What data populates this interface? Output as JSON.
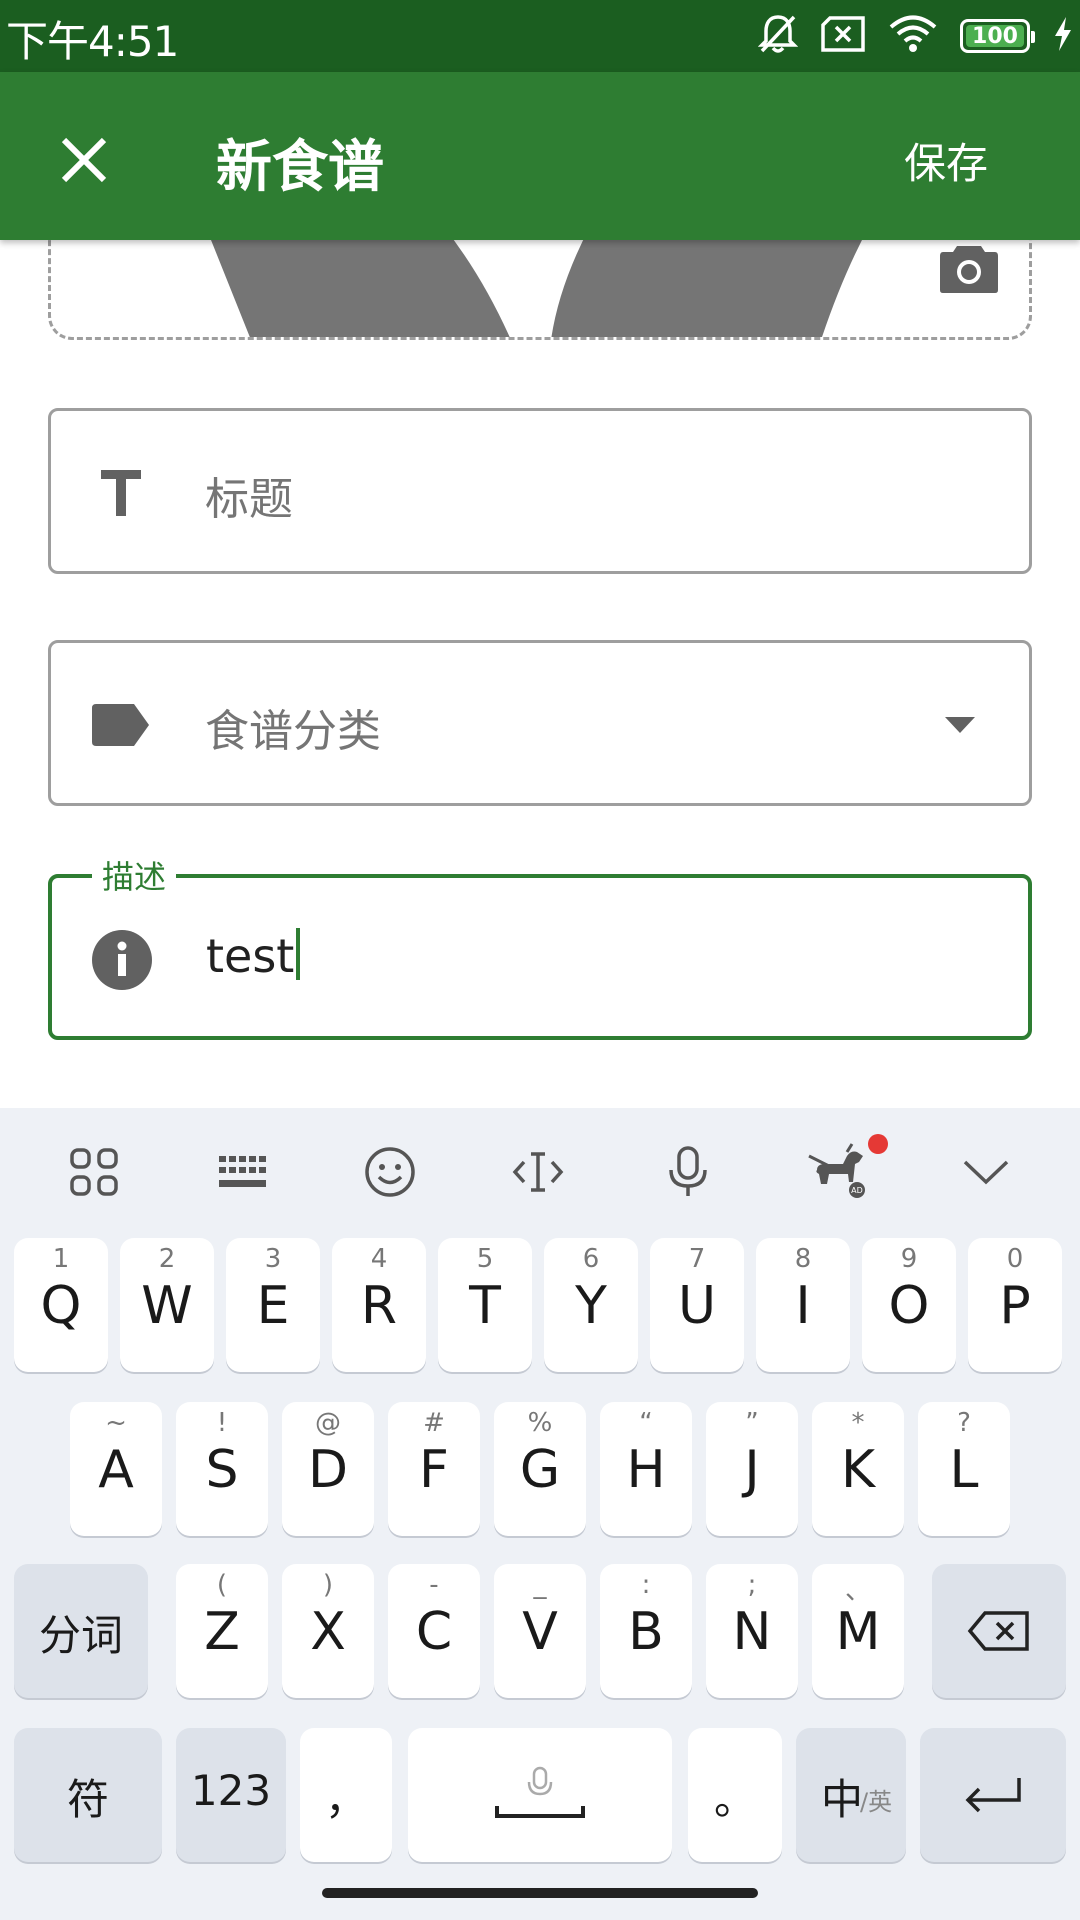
{
  "status_bar": {
    "time": "下午4:51",
    "battery": "100"
  },
  "app_bar": {
    "title": "新食谱",
    "save_label": "保存"
  },
  "form": {
    "title_placeholder": "标题",
    "category_placeholder": "食谱分类",
    "description_label": "描述",
    "description_value": "test"
  },
  "keyboard": {
    "row1": [
      {
        "k": "Q",
        "s": "1"
      },
      {
        "k": "W",
        "s": "2"
      },
      {
        "k": "E",
        "s": "3"
      },
      {
        "k": "R",
        "s": "4"
      },
      {
        "k": "T",
        "s": "5"
      },
      {
        "k": "Y",
        "s": "6"
      },
      {
        "k": "U",
        "s": "7"
      },
      {
        "k": "I",
        "s": "8"
      },
      {
        "k": "O",
        "s": "9"
      },
      {
        "k": "P",
        "s": "0"
      }
    ],
    "row2": [
      {
        "k": "A",
        "s": "~"
      },
      {
        "k": "S",
        "s": "!"
      },
      {
        "k": "D",
        "s": "@"
      },
      {
        "k": "F",
        "s": "#"
      },
      {
        "k": "G",
        "s": "%"
      },
      {
        "k": "H",
        "s": "“"
      },
      {
        "k": "J",
        "s": "”"
      },
      {
        "k": "K",
        "s": "*"
      },
      {
        "k": "L",
        "s": "?"
      }
    ],
    "row3": [
      {
        "k": "Z",
        "s": "("
      },
      {
        "k": "X",
        "s": ")"
      },
      {
        "k": "C",
        "s": "-"
      },
      {
        "k": "V",
        "s": "_"
      },
      {
        "k": "B",
        "s": ":"
      },
      {
        "k": "N",
        "s": ";"
      },
      {
        "k": "M",
        "s": "、"
      }
    ],
    "segment_label": "分词",
    "symbols_label": "符",
    "numbers_label": "123",
    "comma_label": "，",
    "period_label": "。",
    "lang_label": "中",
    "lang_sub": "/英"
  },
  "colors": {
    "primary": "#2e7d32",
    "primary_dark": "#1b5e20",
    "notification_dot": "#e53935"
  }
}
